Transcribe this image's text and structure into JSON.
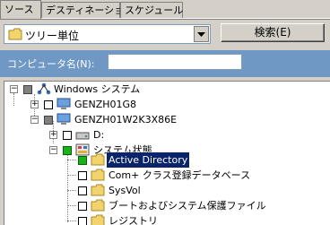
{
  "tabs": [
    "ソース",
    "デスティネーション",
    "スケジュール"
  ],
  "toolbar": {
    "view_select": "ツリー単位",
    "search_button": "検索(E)"
  },
  "filter": {
    "label": "コンピュータ名(N):",
    "value": ""
  },
  "tree": {
    "root": "Windows システム",
    "hosts": [
      "GENZH01G8",
      "GENZH01W2K3X86E"
    ],
    "drive": "D:",
    "system_state": "システム状態",
    "items": [
      "Active Directory",
      "Com+ クラス登録データベース",
      "SysVol",
      "ブートおよびシステム保護ファイル",
      "レジストリ"
    ],
    "selected": "Active Directory"
  },
  "colors": {
    "band": "#6f98c5",
    "selection": "#0a246a",
    "green_check": "#19b219"
  }
}
